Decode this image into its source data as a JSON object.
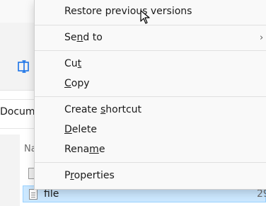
{
  "explorer": {
    "address_text": "Docume",
    "column_header": "Na",
    "selected_file": {
      "name": "file",
      "size_fragment": "29"
    }
  },
  "context_menu": {
    "items": [
      {
        "label_pre": "Restore previous versions",
        "label_u": "",
        "label_post": ""
      },
      {
        "label_pre": "Se",
        "label_u": "n",
        "label_post": "d to",
        "submenu": true,
        "arrow": "›"
      },
      {
        "label_pre": "Cu",
        "label_u": "t",
        "label_post": ""
      },
      {
        "label_pre": "",
        "label_u": "C",
        "label_post": "opy"
      },
      {
        "label_pre": "Create ",
        "label_u": "s",
        "label_post": "hortcut"
      },
      {
        "label_pre": "",
        "label_u": "D",
        "label_post": "elete"
      },
      {
        "label_pre": "Rena",
        "label_u": "m",
        "label_post": "e"
      },
      {
        "label_pre": "P",
        "label_u": "r",
        "label_post": "operties"
      }
    ]
  },
  "colors": {
    "selection_fill": "#cce8ff",
    "selection_border": "#99d1ff",
    "menu_background": "#f9f9f9",
    "rename_icon_accent": "#1a73e8"
  },
  "icons": {
    "ribbon": "rename-icon",
    "file": "text-file-icon",
    "cursor": "mouse-pointer-icon",
    "submenu": "chevron-right-icon"
  }
}
